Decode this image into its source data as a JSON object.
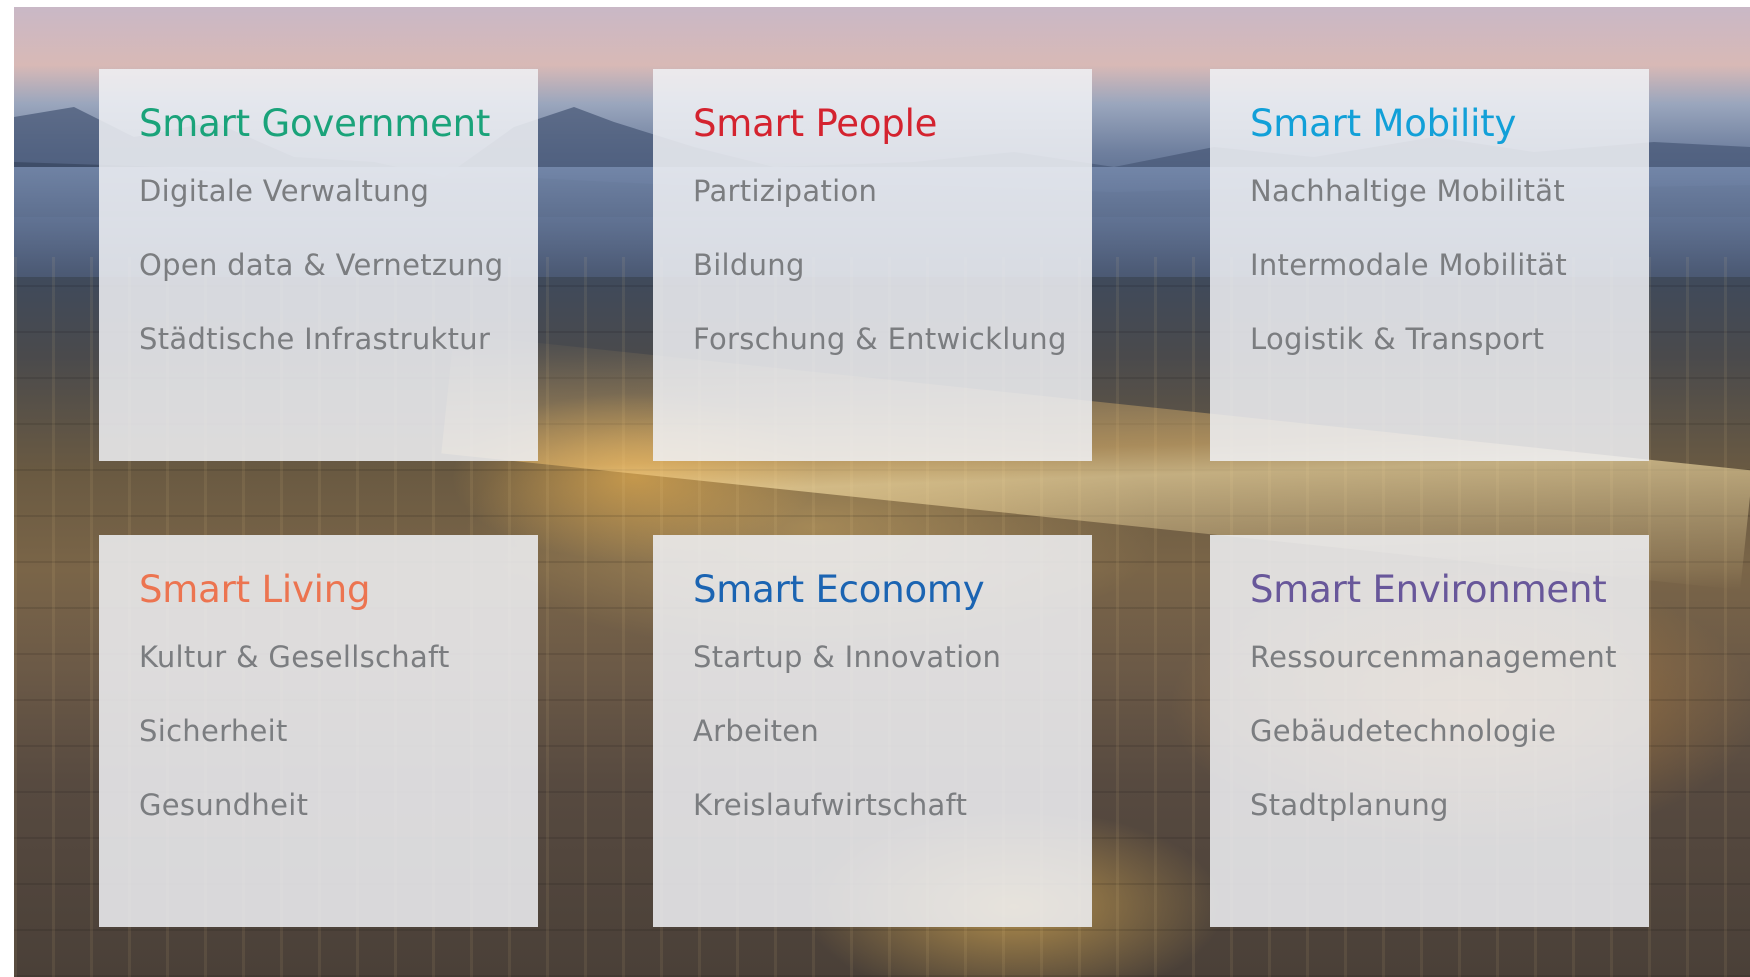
{
  "accent_colors": {
    "government": "#1aa37a",
    "people": "#d4232f",
    "mobility": "#12a0d8",
    "living": "#ec7450",
    "economy": "#1b64b2",
    "environment": "#68579a"
  },
  "cards": [
    {
      "title": "Smart Government",
      "color": "#1aa37a",
      "items": [
        "Digitale Verwaltung",
        "Open data & Vernetzung",
        "Städtische Infrastruktur"
      ]
    },
    {
      "title": "Smart People",
      "color": "#d4232f",
      "items": [
        "Partizipation",
        "Bildung",
        "Forschung & Entwicklung"
      ]
    },
    {
      "title": "Smart Mobility",
      "color": "#12a0d8",
      "items": [
        "Nachhaltige Mobilität",
        "Intermodale Mobilität",
        "Logistik & Transport"
      ]
    },
    {
      "title": "Smart Living",
      "color": "#ec7450",
      "items": [
        "Kultur & Gesellschaft",
        "Sicherheit",
        "Gesundheit"
      ]
    },
    {
      "title": "Smart Economy",
      "color": "#1b64b2",
      "items": [
        "Startup & Innovation",
        "Arbeiten",
        "Kreislaufwirtschaft"
      ]
    },
    {
      "title": "Smart Environment",
      "color": "#68579a",
      "items": [
        "Ressourcenmanagement",
        "Gebäudetechnologie",
        "Stadtplanung"
      ]
    }
  ]
}
